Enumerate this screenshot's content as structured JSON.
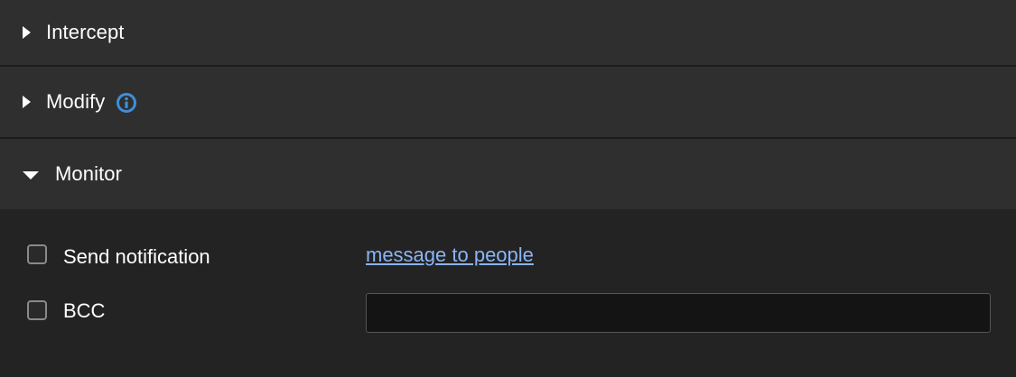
{
  "sections": {
    "intercept": {
      "label": "Intercept",
      "expanded": false
    },
    "modify": {
      "label": "Modify",
      "expanded": false,
      "icon": "info-icon"
    },
    "monitor": {
      "label": "Monitor",
      "expanded": true
    }
  },
  "monitor_panel": {
    "send_notification": {
      "label": "Send notification",
      "checked": false,
      "link_text": "message to people"
    },
    "bcc": {
      "label": "BCC",
      "checked": false,
      "value": "",
      "placeholder": ""
    }
  },
  "colors": {
    "header_bg": "#2f2f2f",
    "panel_bg": "#232323",
    "link": "#8ab4f8",
    "info_icon": "#3f8ed8"
  }
}
